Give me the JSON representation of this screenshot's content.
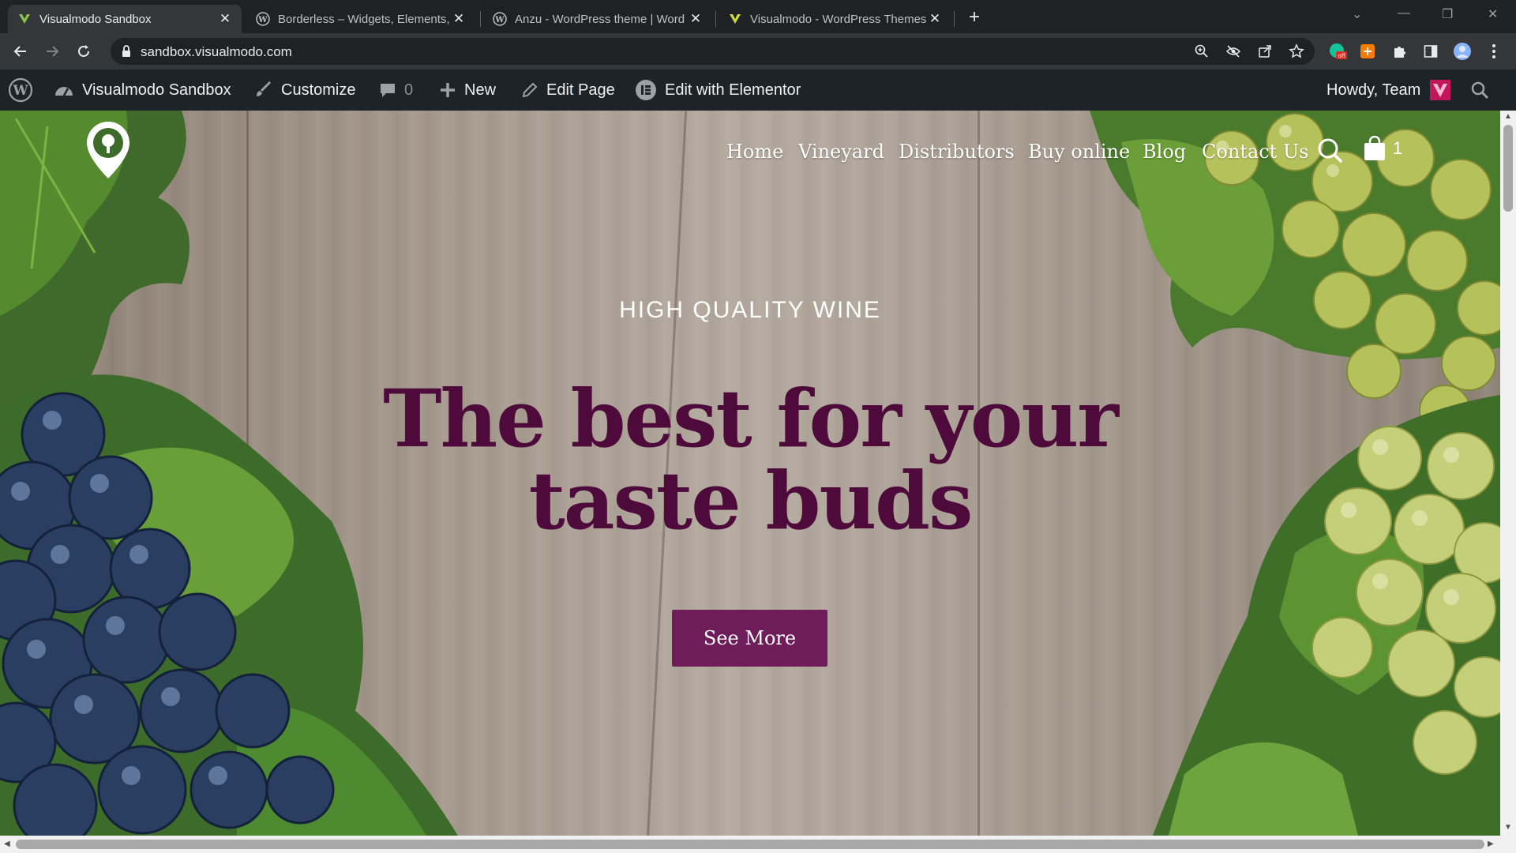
{
  "browser": {
    "tabs": [
      {
        "title": "Visualmodo Sandbox",
        "favicon": "visualmodo-icon",
        "active": true
      },
      {
        "title": "Borderless – Widgets, Elements, ",
        "favicon": "wordpress-icon",
        "active": false
      },
      {
        "title": "Anzu - WordPress theme | Word",
        "favicon": "wordpress-icon",
        "active": false
      },
      {
        "title": "Visualmodo - WordPress Themes",
        "favicon": "visualmodo-icon",
        "active": false
      }
    ],
    "new_tab_label": "+",
    "url": "sandbox.visualmodo.com"
  },
  "admin_bar": {
    "site_name": "Visualmodo Sandbox",
    "customize": "Customize",
    "comments_count": "0",
    "new": "New",
    "edit_page": "Edit Page",
    "edit_elementor": "Edit with Elementor",
    "howdy": "Howdy, Team"
  },
  "site": {
    "nav": [
      "Home",
      "Vineyard",
      "Distributors",
      "Buy online",
      "Blog",
      "Contact Us"
    ],
    "cart_count": "1",
    "hero": {
      "eyebrow": "HIGH QUALITY WINE",
      "headline_line1": "The best for your",
      "headline_line2": "taste buds",
      "cta": "See More"
    }
  },
  "colors": {
    "headline": "#4d0a3a",
    "cta_bg": "#6e1d5a",
    "admin_bar_bg": "#1d2327"
  }
}
